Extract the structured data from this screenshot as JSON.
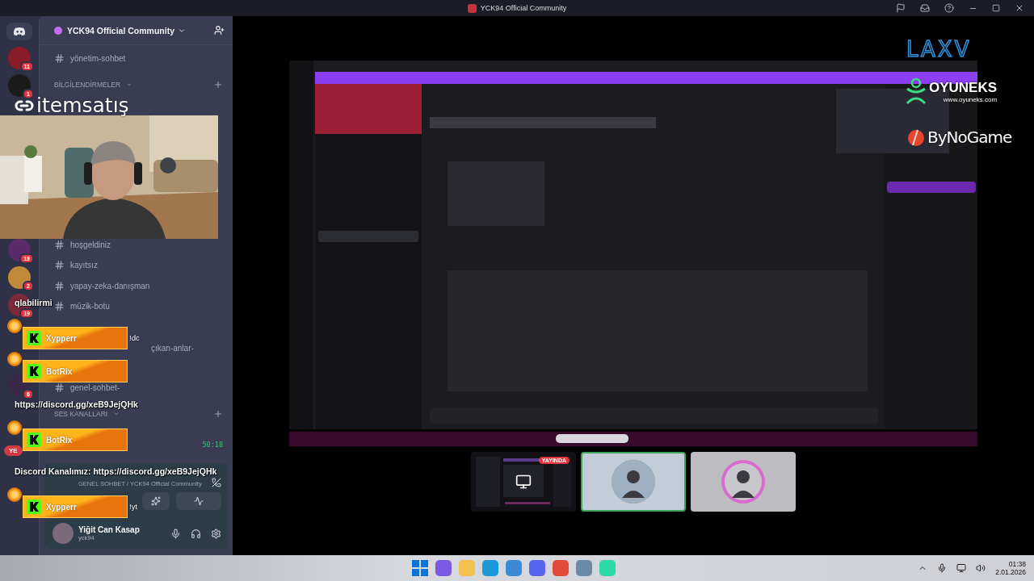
{
  "window": {
    "title": "YCK94 Official Community"
  },
  "servers": {
    "top": [
      {
        "badge": "11"
      },
      {
        "badge": "1"
      }
    ],
    "bottom": [
      {
        "badge": "19"
      },
      {
        "badge": "2"
      },
      {
        "badge": "19"
      },
      {
        "badge": "6"
      }
    ],
    "pill": "YE"
  },
  "sidebar": {
    "server_name": "YCK94 Official Community",
    "top": [
      {
        "kind": "channel",
        "name": "yönetim-sohbet"
      },
      {
        "kind": "category",
        "name": "BİLGİLENDİRMELER"
      }
    ],
    "groups": [
      [
        {
          "kind": "channel",
          "name": "hoşgeldiniz"
        },
        {
          "kind": "channel",
          "name": "kayıtsız"
        },
        {
          "kind": "channel",
          "name": "yapay-zeka-danışman"
        },
        {
          "kind": "channel",
          "name": "müzik-botu"
        }
      ],
      [
        {
          "kind": "fragment",
          "name": "çıkan-anlar-"
        }
      ],
      [
        {
          "kind": "channel",
          "name": "genel-sohbet-"
        },
        {
          "kind": "category",
          "name": "SES KANALLARI"
        }
      ],
      [
        {
          "kind": "timer",
          "name": "50:18"
        }
      ]
    ],
    "voice": {
      "connection": "GENEL SOHBET / YCK94 Official Community",
      "user": "Yiğit Can Kasap",
      "handle": "yck94"
    }
  },
  "chat_overlay": [
    {
      "kind": "text",
      "text": "qlabilirmi"
    },
    {
      "kind": "alert",
      "name": "Xypperr",
      "message": "!dc"
    },
    {
      "kind": "alert",
      "name": "BotRix"
    },
    {
      "kind": "text",
      "text": "https://discord.gg/xeB9JejQHk"
    },
    {
      "kind": "alert",
      "name": "BotRix"
    },
    {
      "kind": "text",
      "text": "Discord Kanalımız: https://discord.gg/xeB9JejQHk"
    },
    {
      "kind": "alert",
      "name": "Xypperr",
      "message": "!yt"
    }
  ],
  "overlay_logos": [
    {
      "kind": "itemsatis",
      "text": "itemsatış"
    },
    {
      "kind": "laxv",
      "text": "LAXV"
    },
    {
      "kind": "oyuneks",
      "text": "OYUNEKS",
      "subtext": "www.oyuneks.com"
    },
    {
      "kind": "bynogame",
      "text": "ByNoGame"
    }
  ],
  "participants": [
    {
      "kind": "screen",
      "badge": "YAYINDA",
      "selected": false
    },
    {
      "kind": "avatar",
      "selected": true
    },
    {
      "kind": "avatar",
      "selected": false
    }
  ],
  "taskbar": {
    "time": "01:38",
    "date": "2.01.2026"
  }
}
